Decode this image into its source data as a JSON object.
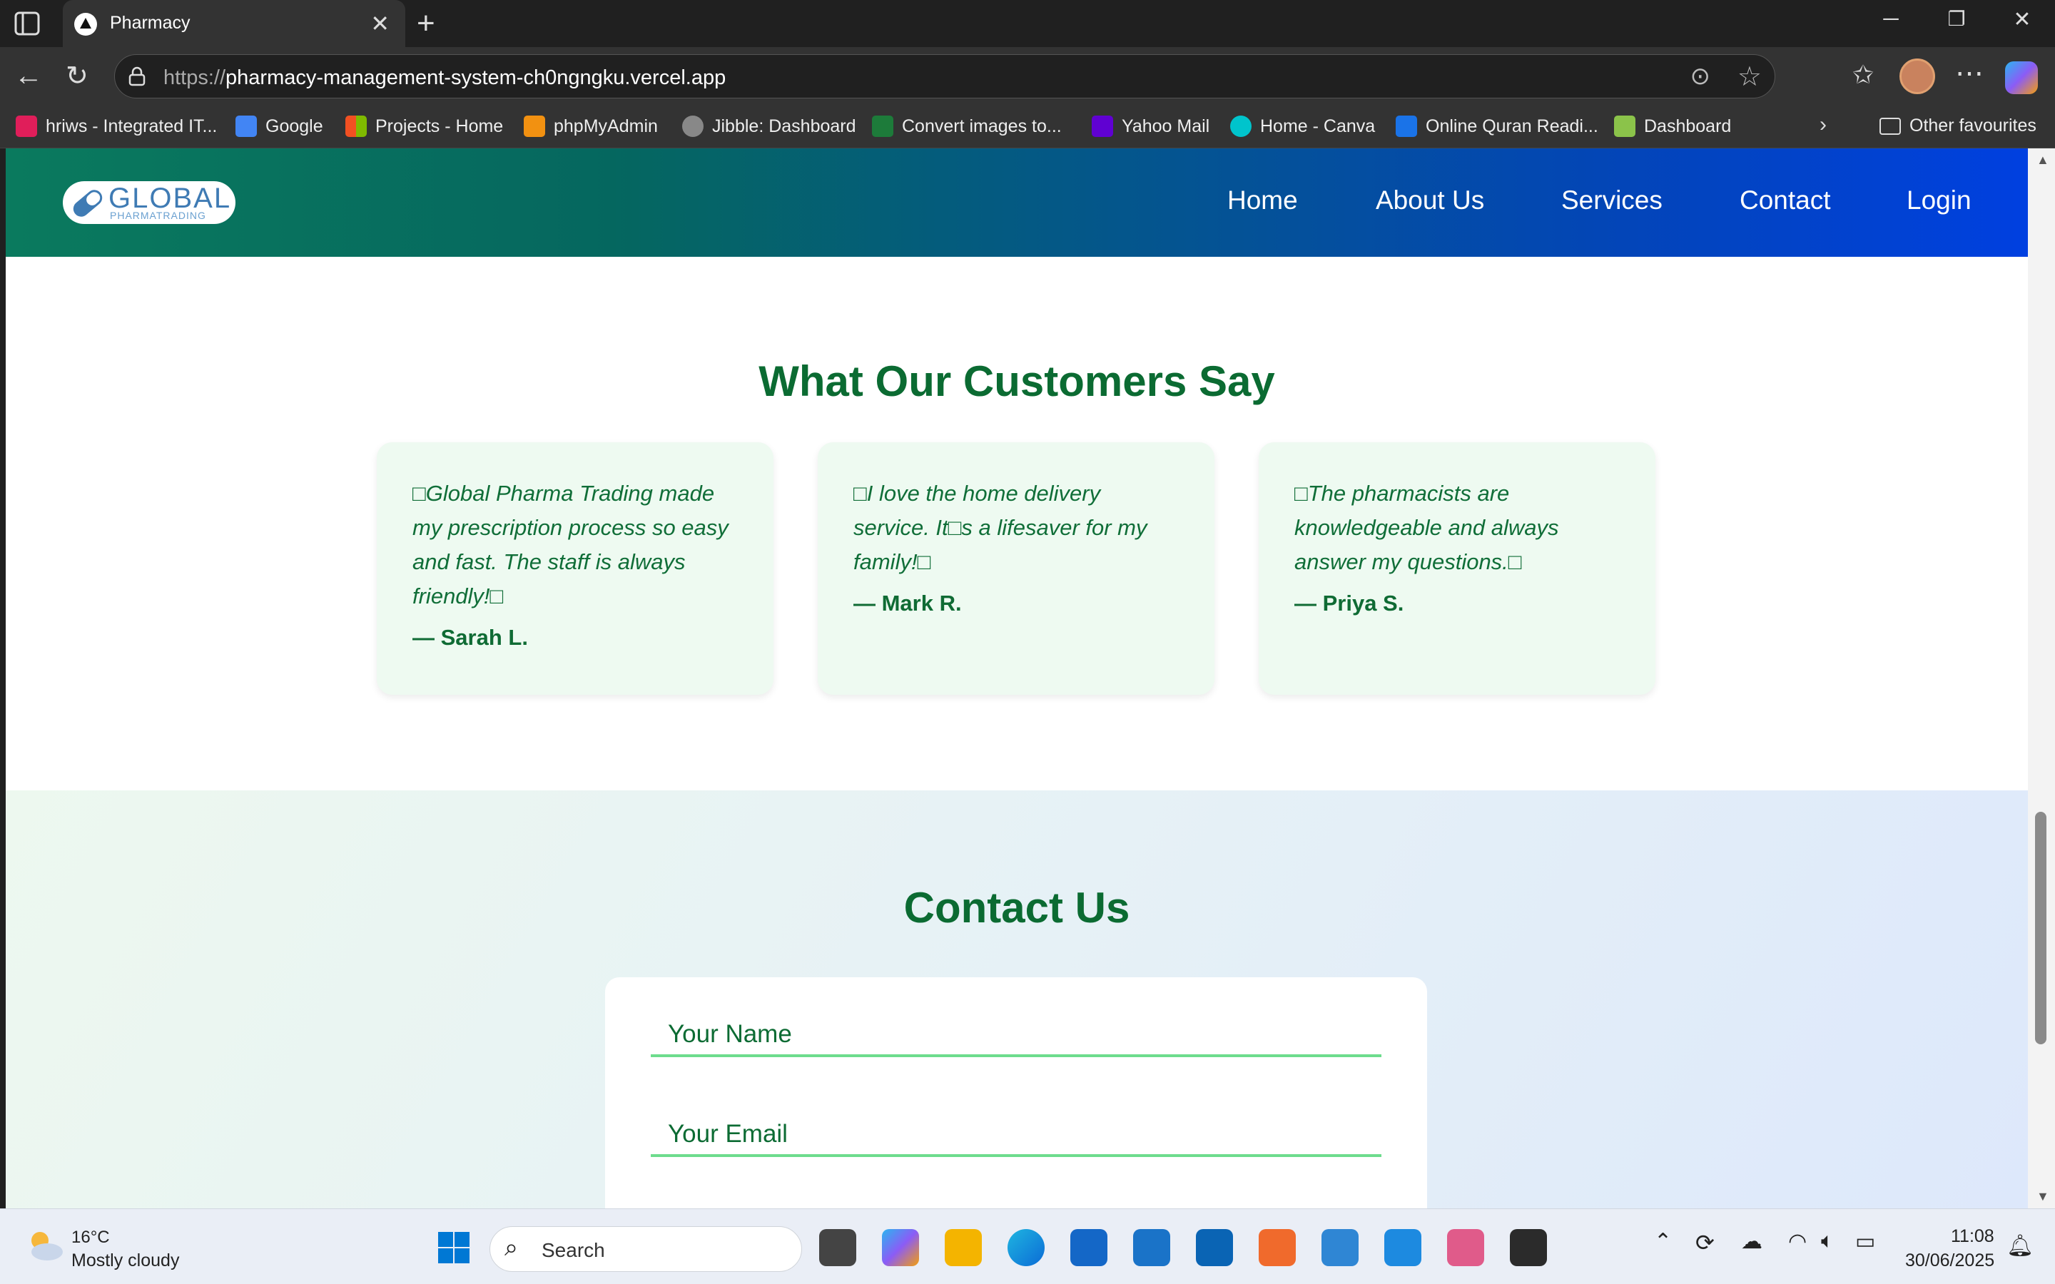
{
  "browser": {
    "tab_title": "Pharmacy",
    "url_proto": "https://",
    "url_host": "pharmacy-management-system-ch0ngngku.vercel.app",
    "bookmarks": [
      {
        "label": "hriws - Integrated IT...",
        "color": "#e01e5a"
      },
      {
        "label": "Google",
        "color": "#4285f4"
      },
      {
        "label": "Projects - Home",
        "color": "#f25022"
      },
      {
        "label": "phpMyAdmin",
        "color": "#f29111"
      },
      {
        "label": "Jibble: Dashboard",
        "color": "#888888"
      },
      {
        "label": "Convert images to...",
        "color": "#1d7b3a"
      },
      {
        "label": "Yahoo Mail",
        "color": "#6001d2"
      },
      {
        "label": "Home - Canva",
        "color": "#00c4cc"
      },
      {
        "label": "Online Quran Readi...",
        "color": "#1a73e8"
      },
      {
        "label": "Dashboard",
        "color": "#8bc34a"
      }
    ],
    "other_favourites": "Other favourites"
  },
  "site": {
    "logo_text": "GLOBAL",
    "logo_sub": "PHARMATRADING",
    "nav": [
      "Home",
      "About Us",
      "Services",
      "Contact",
      "Login"
    ],
    "testimonials_title": "What Our Customers Say",
    "testimonials": [
      {
        "quote": "□Global Pharma Trading made my prescription process so easy and fast. The staff is always friendly!□",
        "author": "— Sarah L."
      },
      {
        "quote": "□I love the home delivery service. It□s a lifesaver for my family!□",
        "author": "— Mark R."
      },
      {
        "quote": "□The pharmacists are knowledgeable and always answer my questions.□",
        "author": "— Priya S."
      }
    ],
    "contact_title": "Contact Us",
    "form": {
      "name_placeholder": "Your Name",
      "email_placeholder": "Your Email"
    },
    "colors": {
      "accent_green": "#0b6b32",
      "nav_start": "#0a7a5e",
      "nav_end": "#0040e0"
    }
  },
  "taskbar": {
    "temperature": "16°C",
    "weather": "Mostly cloudy",
    "search": "Search",
    "time": "11:08",
    "date": "30/06/2025"
  }
}
